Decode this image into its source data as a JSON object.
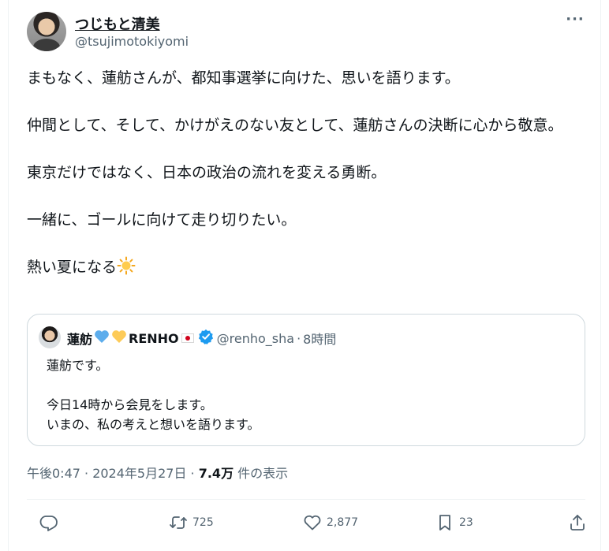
{
  "author": {
    "name": "つじもと清美",
    "handle": "@tsujimotokiyomi"
  },
  "more_label": "···",
  "body_text": "まもなく、蓮舫さんが、都知事選挙に向けた、思いを語ります。\n\n仲間として、そして、かけがえのない友として、蓮舫さんの決断に心から敬意。\n\n東京だけではなく、日本の政治の流れを変える勇断。\n\n一緒に、ゴールに向けて走り切りたい。\n\n熱い夏になる",
  "body_emoji": "sun-emoji",
  "quote": {
    "name": "蓮舫",
    "name_suffix": "RENHO",
    "handle": "@renho_sha",
    "separator": "·",
    "time": "8時間",
    "text": "蓮舫です。\n\n今日14時から会見をします。\nいまの、私の考えと想いを語ります。",
    "badges": [
      "blue-heart",
      "yellow-heart",
      "japan-flag",
      "verified-badge"
    ]
  },
  "meta": {
    "time": "午後0:47 · 2024年5月27日 · ",
    "views": "7.4万",
    "views_label": " 件の表示"
  },
  "actions": {
    "reply_count": "",
    "retweet_count": "725",
    "like_count": "2,877",
    "bookmark_count": "23"
  },
  "colors": {
    "accent": "#1d9bf0",
    "text": "#0f1419",
    "muted": "#536471",
    "border": "#cfd9de"
  }
}
